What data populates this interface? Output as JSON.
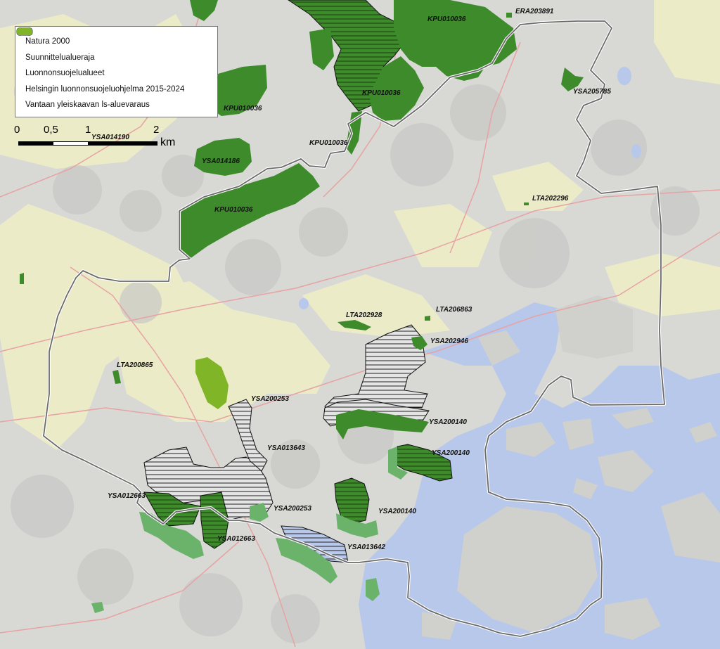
{
  "legend": {
    "items": [
      {
        "label": "Natura 2000",
        "symbol": "natura"
      },
      {
        "label": "Suunnittelualueraja",
        "symbol": "boundary"
      },
      {
        "label": "Luonnonsuojelualueet",
        "symbol": "protected"
      },
      {
        "label": "Helsingin luonnonsuojeluohjelma 2015-2024",
        "symbol": "helsinki"
      },
      {
        "label": "Vantaan yleiskaavan ls-aluevaraus",
        "symbol": "vantaa"
      }
    ]
  },
  "scale": {
    "ticks": [
      "0",
      "0,5",
      "1",
      "2"
    ],
    "unit": "km"
  },
  "colors": {
    "water": "#b8c8ea",
    "land": "#d9d9d6",
    "fields": "#eeeecb",
    "protected": "#3d8b2b",
    "helsinki": "#6bb26b",
    "vantaa": "#7fb526",
    "boundary": "#666666",
    "natura_fill": "#e6e6e6",
    "road": "#e7a3a3"
  },
  "labels": [
    "ERA203891",
    "KPU010036",
    "YSA205785",
    "KPU010036",
    "KPU010036",
    "YSA014190",
    "KPU010036",
    "YSA014186",
    "KPU010036",
    "LTA202296",
    "LTA202928",
    "LTA206863",
    "YSA202946",
    "LTA200865",
    "YSA200253",
    "YSA200140",
    "YSA013643",
    "YSA200140",
    "YSA012663",
    "YSA200253",
    "YSA200140",
    "YSA012663",
    "YSA013642"
  ]
}
